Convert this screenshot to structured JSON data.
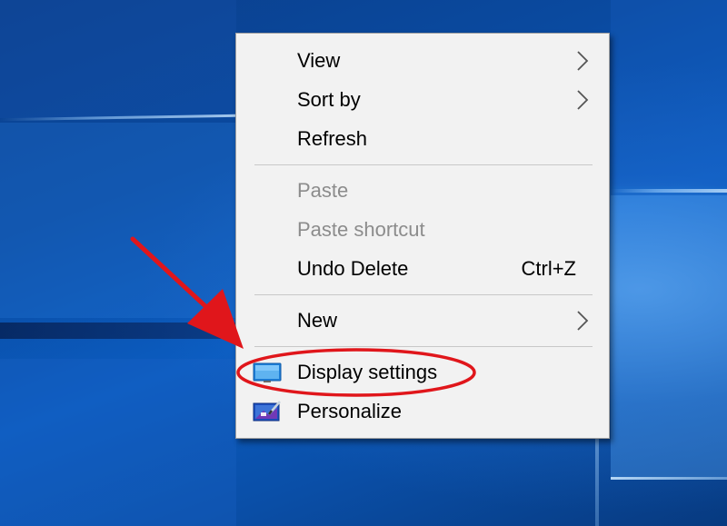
{
  "desktop": {
    "background_color": "#0a4aa0"
  },
  "context_menu": {
    "items": [
      {
        "label": "View",
        "has_submenu": true,
        "enabled": true
      },
      {
        "label": "Sort by",
        "has_submenu": true,
        "enabled": true
      },
      {
        "label": "Refresh",
        "has_submenu": false,
        "enabled": true
      },
      {
        "label": "Paste",
        "has_submenu": false,
        "enabled": false
      },
      {
        "label": "Paste shortcut",
        "has_submenu": false,
        "enabled": false
      },
      {
        "label": "Undo Delete",
        "shortcut": "Ctrl+Z",
        "has_submenu": false,
        "enabled": true
      },
      {
        "label": "New",
        "has_submenu": true,
        "enabled": true
      },
      {
        "label": "Display settings",
        "icon": "display-settings-icon",
        "has_submenu": false,
        "enabled": true
      },
      {
        "label": "Personalize",
        "icon": "personalize-icon",
        "has_submenu": false,
        "enabled": true
      }
    ]
  },
  "annotation": {
    "arrow_color": "#e0161b",
    "highlighted_item": "Display settings"
  }
}
